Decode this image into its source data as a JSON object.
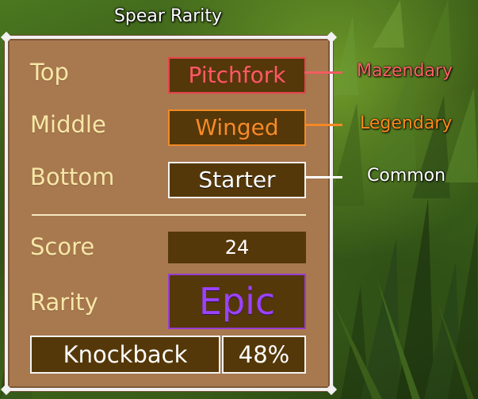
{
  "title": "Spear Rarity",
  "parts": [
    {
      "slot": "Top",
      "name": "Pitchfork",
      "rarity": "Mazendary"
    },
    {
      "slot": "Middle",
      "name": "Winged",
      "rarity": "Legendary"
    },
    {
      "slot": "Bottom",
      "name": "Starter",
      "rarity": "Common"
    }
  ],
  "score": {
    "label": "Score",
    "value": "24"
  },
  "rarity": {
    "label": "Rarity",
    "value": "Epic"
  },
  "knockback": {
    "label": "Knockback",
    "value": "48%"
  },
  "colors": {
    "panel": "#a8784f",
    "box": "#553809",
    "mazendary": "#ff5a63",
    "legendary": "#f58b2a",
    "common": "#ffffff",
    "epic": "#9b42ff",
    "label": "#f7e7a6"
  }
}
